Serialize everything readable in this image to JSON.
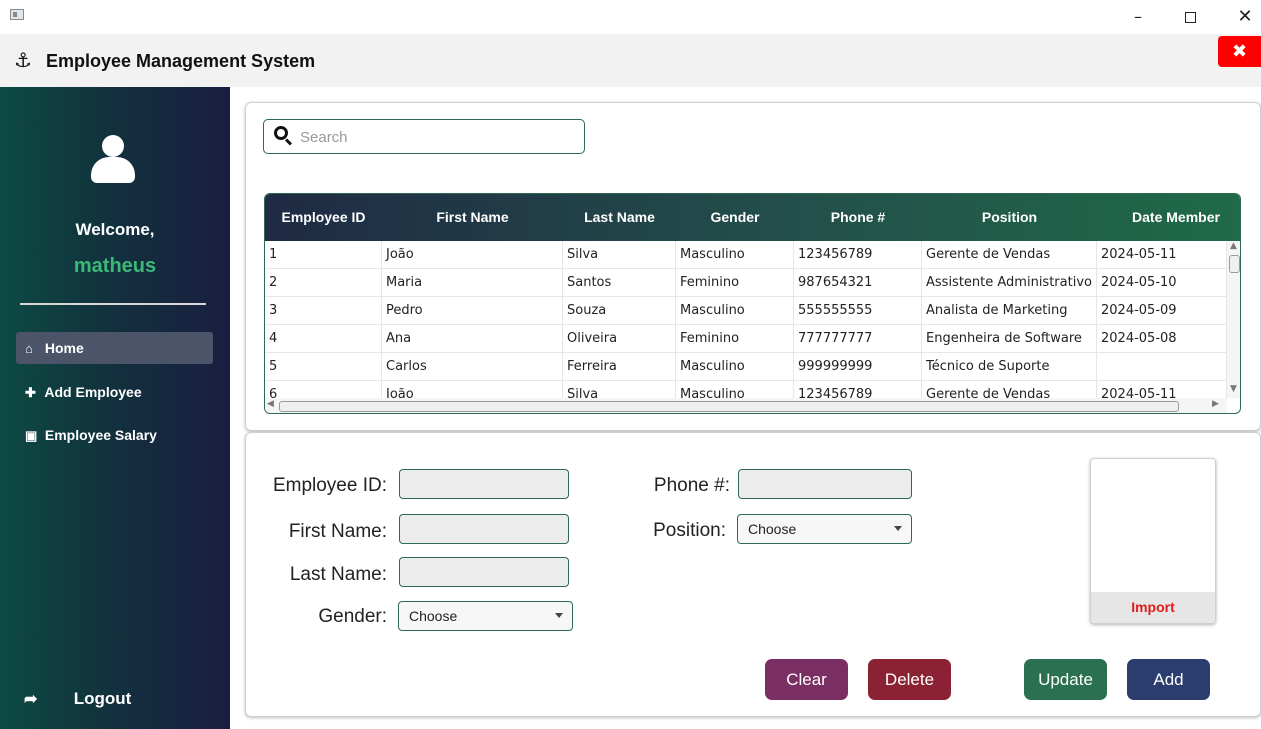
{
  "app": {
    "title": "Employee Management System",
    "close_icon": "close-icon",
    "accent": "#ff0000"
  },
  "window": {
    "minimize_glyph": "–",
    "close_glyph": "✕"
  },
  "sidebar": {
    "welcome": "Welcome,",
    "username": "matheus",
    "items": [
      {
        "label": "Home",
        "icon": "home-icon",
        "active": true
      },
      {
        "label": "Add Employee",
        "icon": "plus-icon",
        "active": false
      },
      {
        "label": "Employee Salary",
        "icon": "money-icon",
        "active": false
      }
    ],
    "logout": "Logout"
  },
  "search": {
    "placeholder": "Search",
    "value": ""
  },
  "table": {
    "columns": [
      "Employee ID",
      "First Name",
      "Last Name",
      "Gender",
      "Phone #",
      "Position",
      "Date Member"
    ],
    "rows": [
      [
        "1",
        "João",
        "Silva",
        "Masculino",
        "123456789",
        "Gerente de Vendas",
        "2024-05-11"
      ],
      [
        "2",
        "Maria",
        "Santos",
        "Feminino",
        "987654321",
        "Assistente Administrativo",
        "2024-05-10"
      ],
      [
        "3",
        "Pedro",
        "Souza",
        "Masculino",
        "555555555",
        "Analista de Marketing",
        "2024-05-09"
      ],
      [
        "4",
        "Ana",
        "Oliveira",
        "Feminino",
        "777777777",
        "Engenheira de Software",
        "2024-05-08"
      ],
      [
        "5",
        "Carlos",
        "Ferreira",
        "Masculino",
        "999999999",
        "Técnico de Suporte",
        ""
      ],
      [
        "6",
        "João",
        "Silva",
        "Masculino",
        "123456789",
        "Gerente de Vendas",
        "2024-05-11"
      ]
    ]
  },
  "form": {
    "employee_id_label": "Employee ID:",
    "first_name_label": "First Name:",
    "last_name_label": "Last Name:",
    "gender_label": "Gender:",
    "gender_value": "Choose",
    "phone_label": "Phone #:",
    "position_label": "Position:",
    "position_value": "Choose",
    "import_label": "Import"
  },
  "actions": {
    "clear": "Clear",
    "delete": "Delete",
    "update": "Update",
    "add": "Add"
  },
  "colors": {
    "clear": "#7a2f64",
    "delete": "#8b2233",
    "update": "#2c7052",
    "add": "#2a3d6e",
    "username": "#3cb878",
    "import": "#e01c1c"
  }
}
